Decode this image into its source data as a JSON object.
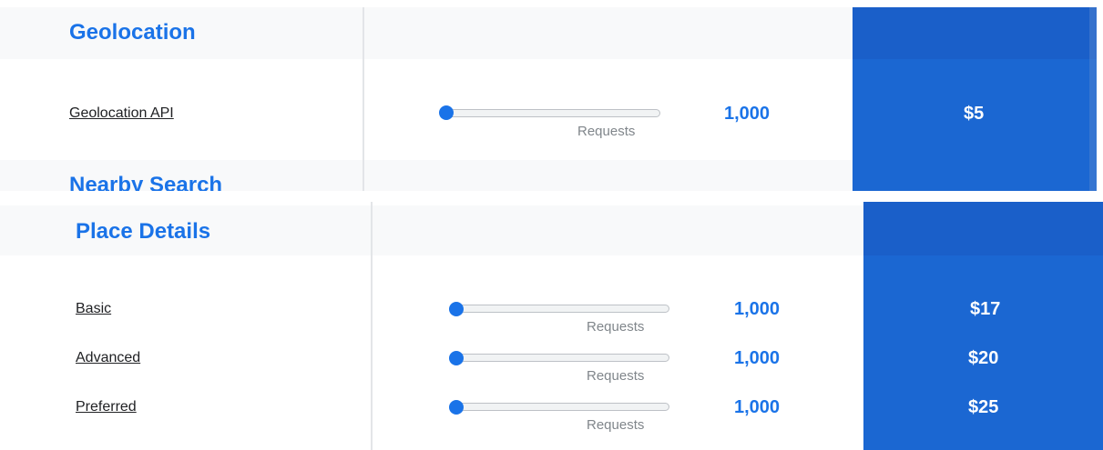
{
  "panel_top": {
    "section_title": "Geolocation",
    "next_section_title": "Nearby Search",
    "rows": [
      {
        "label": "Geolocation API",
        "slider_caption": "Requests",
        "count": "1,000",
        "price": "$5",
        "slider_level": 0
      }
    ]
  },
  "panel_bottom": {
    "section_title": "Place Details",
    "rows": [
      {
        "label": "Basic",
        "slider_caption": "Requests",
        "count": "1,000",
        "price": "$17",
        "slider_level": 0
      },
      {
        "label": "Advanced",
        "slider_caption": "Requests",
        "count": "1,000",
        "price": "$20",
        "slider_level": 0
      },
      {
        "label": "Preferred",
        "slider_caption": "Requests",
        "count": "1,000",
        "price": "$25",
        "slider_level": 0
      }
    ]
  },
  "colors": {
    "accent": "#1a73e8",
    "price_column": "#1b67d2",
    "section_band": "#f8f9fa"
  }
}
